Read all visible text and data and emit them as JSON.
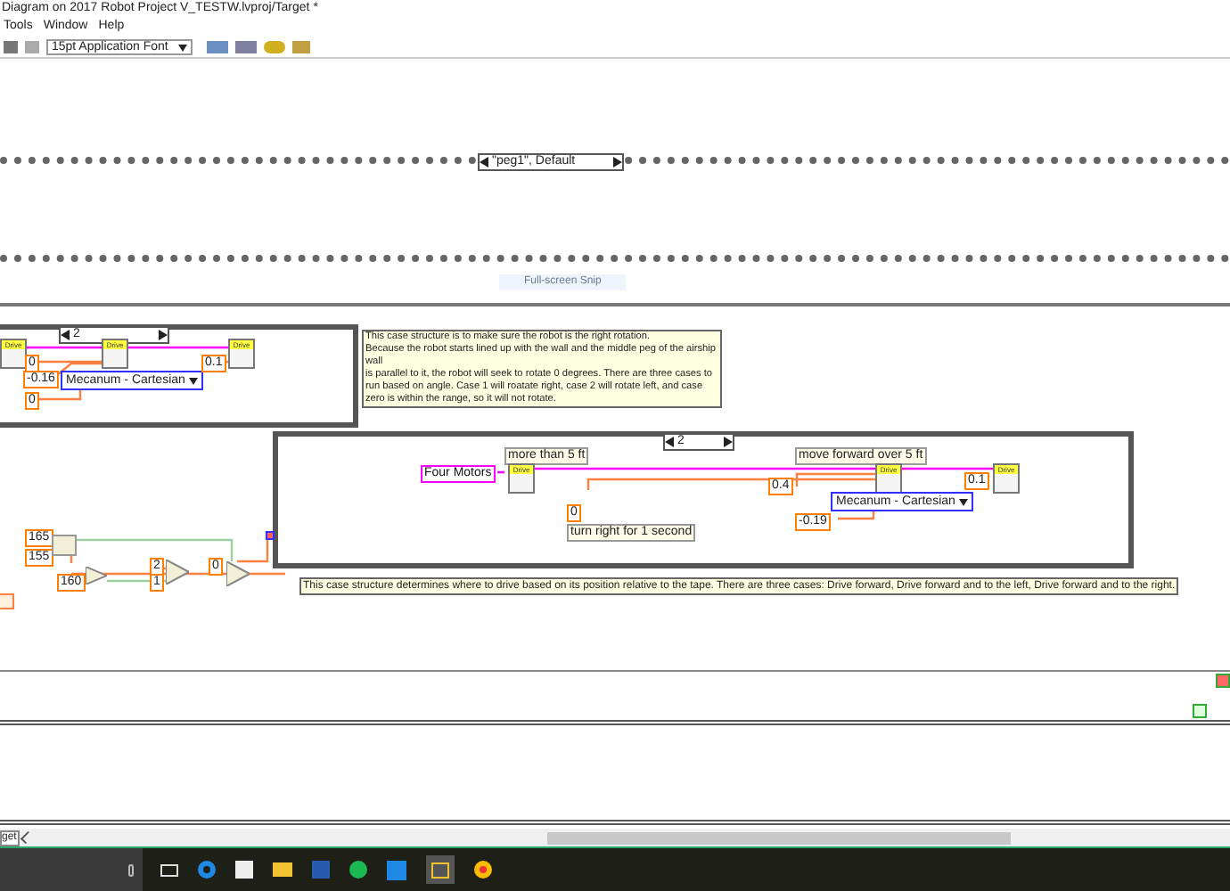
{
  "window": {
    "title": "Diagram on 2017 Robot Project V_TESTW.lvproj/Target *"
  },
  "menu": [
    "Tools",
    "Window",
    "Help"
  ],
  "toolbar": {
    "font": "15pt Application Font"
  },
  "outer_case": {
    "selector": "\"peg1\", Default"
  },
  "snip_tooltip": "Full-screen Snip",
  "rotation_case": {
    "selector": "2",
    "nodes": [
      "Drive",
      "Drive",
      "Drive"
    ],
    "constants": [
      "0",
      "-0.16",
      "0",
      "0.1"
    ],
    "enum": "Mecanum - Cartesian"
  },
  "rotation_comment": "This case structure is to make sure the robot is the right rotation.\nBecause the robot starts lined up with the wall and the middle peg of the airship wall\nis parallel to it, the robot will seek to rotate 0 degrees. There are three cases to run based on angle. Case 1 will roatate right, case 2 will rotate left, and case zero is within the range, so it will not rotate.",
  "logic_constants": [
    "165",
    "155",
    "160",
    "2",
    "1",
    "0"
  ],
  "drive_case": {
    "selector": "2",
    "labels": [
      "more than 5 ft",
      "move forward over 5 ft",
      "turn right for 1 second"
    ],
    "string_constant": "Four Motors",
    "nodes": [
      "Drive",
      "Drive",
      "Drive"
    ],
    "constants": [
      "0.4",
      "0",
      "-0.19",
      "0.1"
    ],
    "enum": "Mecanum - Cartesian"
  },
  "drive_comment": "This case structure determines where to drive based on its position relative to the tape. There are three cases: Drive forward, Drive forward and to the left, Drive forward and to the right.",
  "status_bar": {
    "target": "get"
  }
}
